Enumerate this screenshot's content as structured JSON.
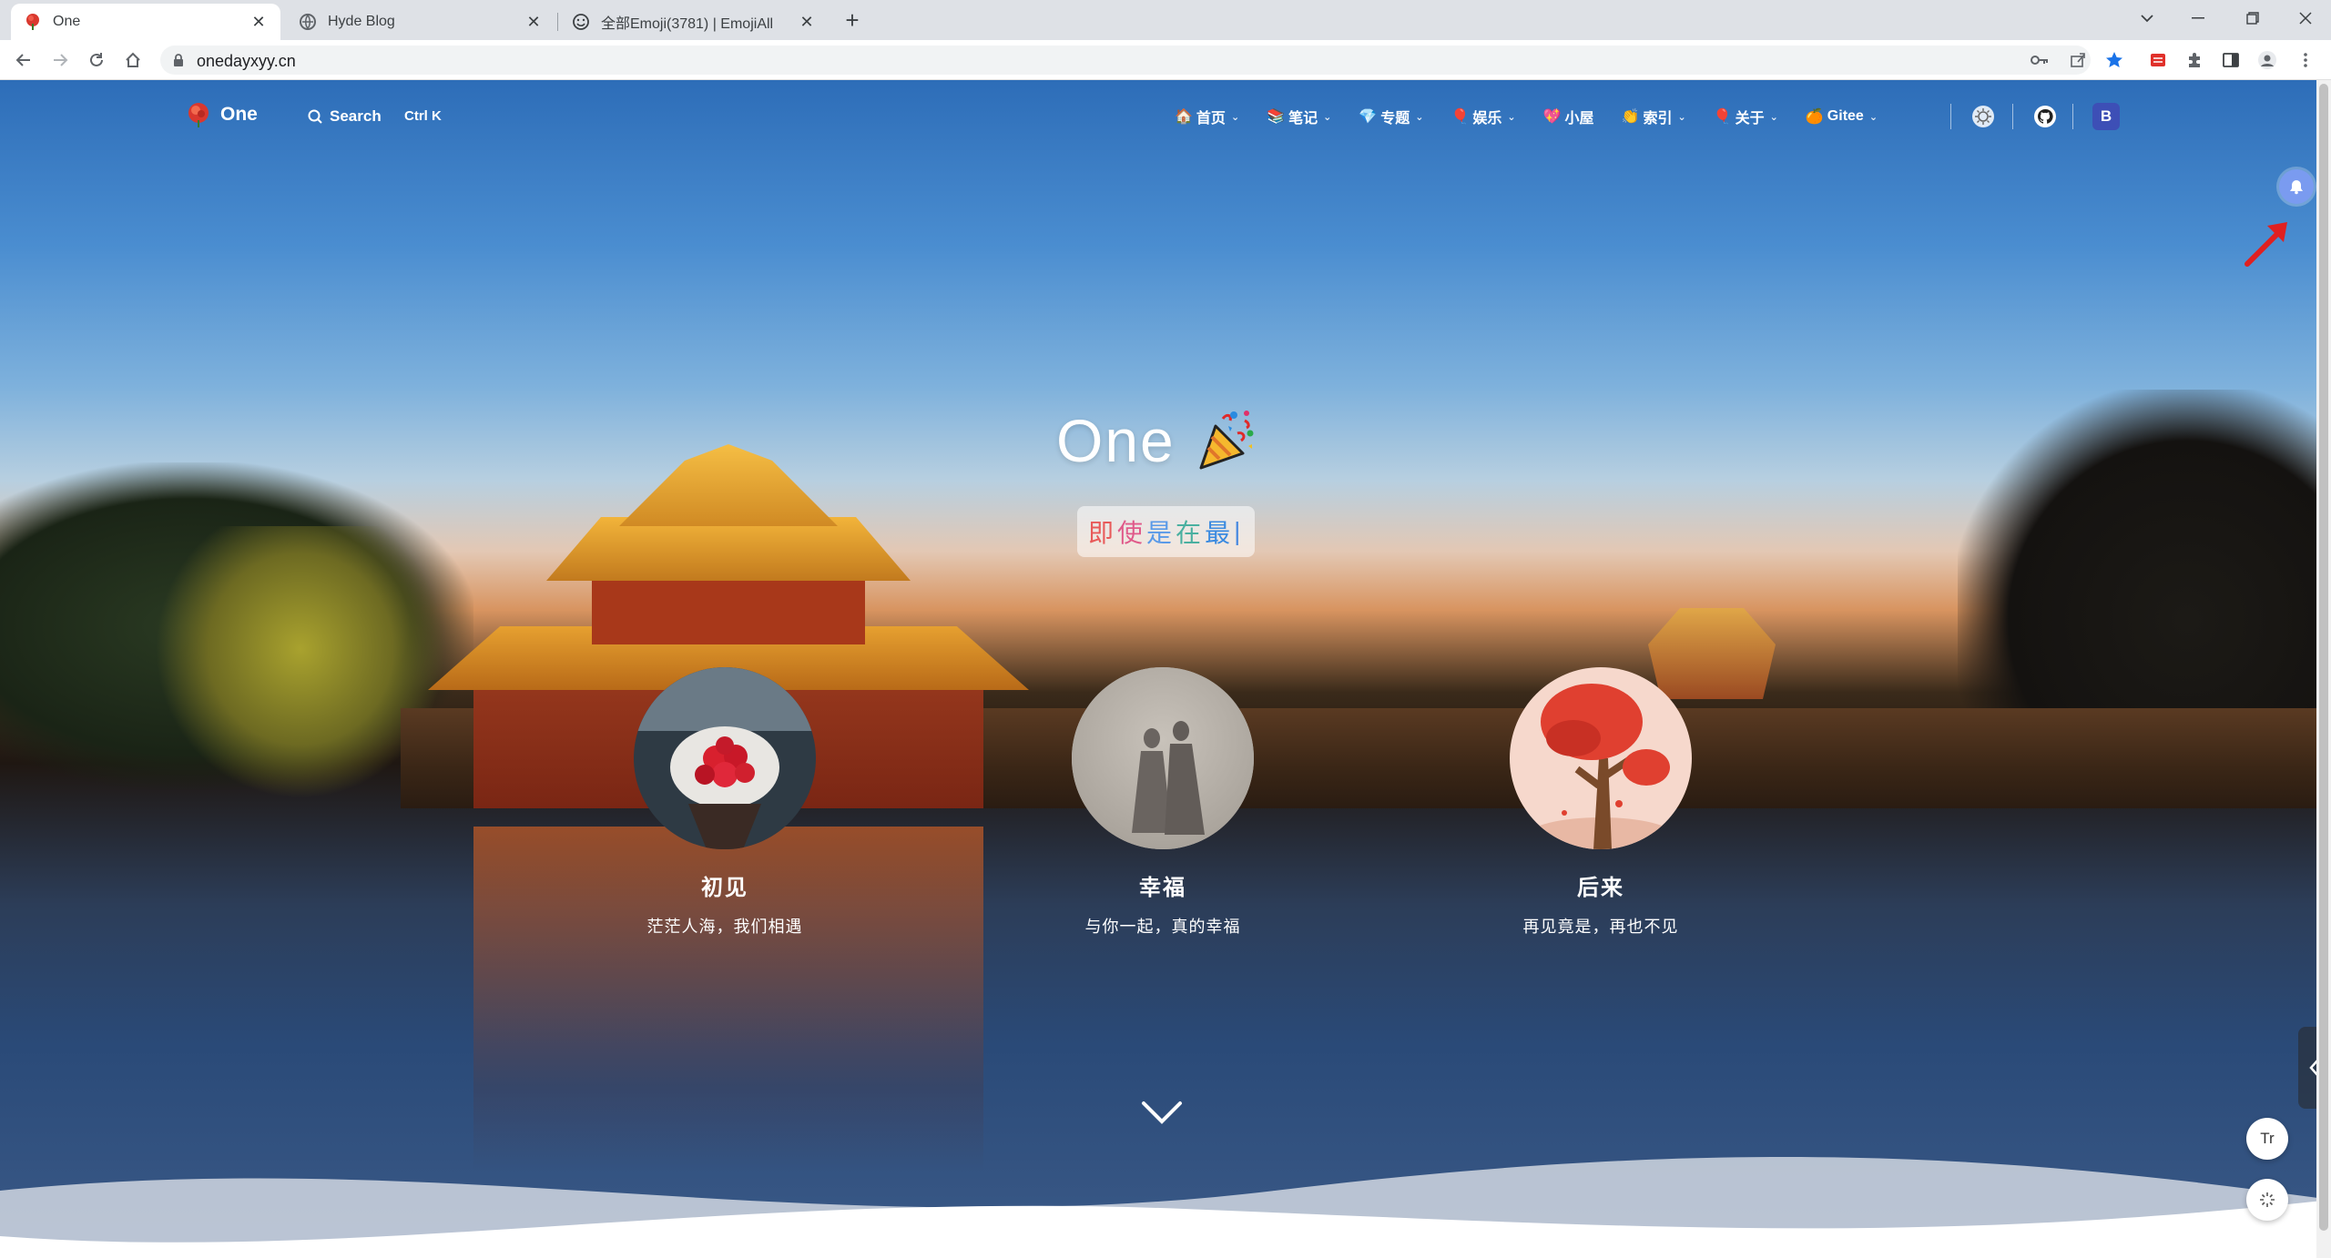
{
  "browser": {
    "tabs": [
      {
        "title": "One",
        "active": true
      },
      {
        "title": "Hyde Blog",
        "active": false
      },
      {
        "title": "全部Emoji(3781) | EmojiAll",
        "active": false
      }
    ],
    "url": "onedayxyy.cn"
  },
  "site": {
    "brand": "One",
    "search_label": "Search",
    "search_shortcut": "Ctrl K",
    "menu": [
      {
        "emoji": "🏠",
        "label": "首页",
        "caret": true
      },
      {
        "emoji": "📚",
        "label": "笔记",
        "caret": true
      },
      {
        "emoji": "💎",
        "label": "专题",
        "caret": true
      },
      {
        "emoji": "🎈",
        "label": "娱乐",
        "caret": true
      },
      {
        "emoji": "💖",
        "label": "小屋",
        "caret": false
      },
      {
        "emoji": "👏",
        "label": "索引",
        "caret": true
      },
      {
        "emoji": "🎈",
        "label": "关于",
        "caret": true
      },
      {
        "emoji": "🍊",
        "label": "Gitee",
        "caret": true
      }
    ],
    "avatar_letter": "B"
  },
  "hero": {
    "title": "One",
    "typing": [
      "即",
      "使",
      "是",
      "在",
      "最",
      "|"
    ],
    "cards": [
      {
        "title": "初见",
        "subtitle": "茫茫人海，我们相遇"
      },
      {
        "title": "幸福",
        "subtitle": "与你一起，真的幸福"
      },
      {
        "title": "后来",
        "subtitle": "再见竟是，再也不见"
      }
    ]
  },
  "fabs": {
    "font_label": "Tr"
  },
  "colors": {
    "accent": "#3d4fb6",
    "notify": "#7a9bf0",
    "annotation": "#e02020"
  }
}
